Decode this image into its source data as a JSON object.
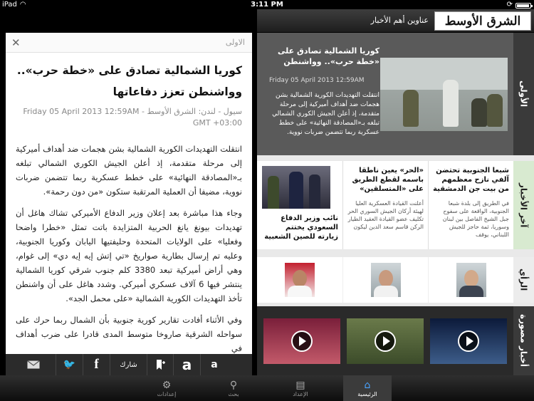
{
  "status": {
    "device": "iPad",
    "time": "3:11 PM"
  },
  "header": {
    "logo": "الشرق الأوسط",
    "title": "عناوين أهم الأخبار"
  },
  "article": {
    "section": "الاولى",
    "headline": "كوريا الشمالية تصادق على «خطة حرب».. وواشنطن تعزز دفاعاتها",
    "meta": "سيول - لندن: الشرق الأوسط - Friday 05 April 2013 12:59AM GMT +03:00",
    "paragraphs": [
      "انتقلت التهديدات الكورية الشمالية بشن هجمات ضد أهداف أميركية إلى مرحلة متقدمة، إذ أعلن الجيش الكوري الشمالي تبلغه بـ«المصادقة النهائية» على خطط عسكرية ربما تتضمن ضربات نووية، مضيفا أن العملية المرتقبة ستكون «من دون رحمة».",
      "وجاء هذا مباشرة بعد إعلان وزير الدفاع الأميركي تشاك هاغل أن تهديدات بيونغ يانغ الحربية المتزايدة باتت تمثل «خطرا واضحا وفعليا» على الولايات المتحدة وحليفتيها اليابان وكوريا الجنوبية، وعليه تم إرسال بطارية صواريخ «تي إتش إيه إيه دي» إلى غوام، وهي أراض أميركية تبعد 3380 كلم جنوب شرقي كوريا الشمالية ينتشر فيها 6 آلاف عسكري أميركي. وشدد هاغل على أن واشنطن تأخذ التهديدات الكورية الشمالية «على محمل الجد».",
      "وفي الأثناء أفادت تقارير كورية جنوبية بأن الشمال ربما حرك على سواحله الشرقية صاروخا متوسط المدى قادرا على ضرب أهداف في"
    ],
    "toolbar": {
      "share_label": "شارك",
      "font_small": "a",
      "font_large": "a"
    }
  },
  "sections": {
    "first": "الأولى",
    "latest": "آخر الأخبار",
    "opinion": "الرأي",
    "videos": "أخبار مصورة"
  },
  "featured": {
    "title": "كوريا الشمالية تصادق على «خطة حرب».. وواشنطن",
    "date": "Friday 05 April 2013 12:59AM",
    "text": "انتقلت التهديدات الكورية الشمالية بشن هجمات ضد أهداف أميركية إلى مرحلة متقدمة، إذ أعلن الجيش الكوري الشمالي تبلغه بـ«المصادقة النهائية» على خطط عسكرية ربما تتضمن ضربات نووية."
  },
  "latest_news": [
    {
      "title": "شبعا الجنوبية تحتضن آلفي نازح معظمهم من بيت جن الدمشقية",
      "text": "في الطريق إلى بلدة شبعا الجنوبية، الواقعة على سفوح جبل الشيخ الفاصل بين لبنان وسوريا، ثمة حاجز للجيش اللبناني، يوقف"
    },
    {
      "title": "«الحر» يعين ناطقا باسمه لقطع الطريق على «المتسلقين»",
      "text": "أعلنت القيادة العسكرية العليا لهيئة أركان الجيش السوري الحر تكليف عضو القيادة العقيد الطيار الركن قاسم سعد الدين ليكون"
    },
    {
      "title": "نائب وزير الدفاع السعودي يختتم زيارته للصين الشعبية"
    }
  ],
  "tabbar": {
    "home": "الرئيسية",
    "archive": "الإعداد",
    "search": "بحث",
    "settings": "إعدادات"
  }
}
